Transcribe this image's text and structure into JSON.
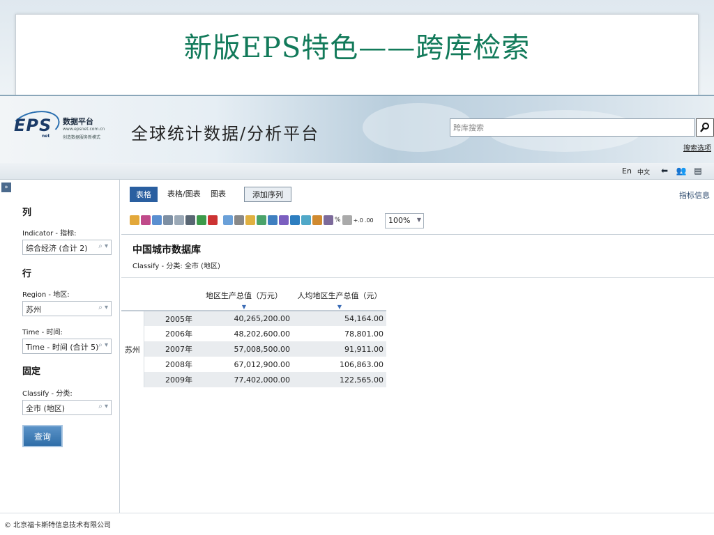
{
  "slide": {
    "title": "新版EPS特色——跨库检索"
  },
  "header": {
    "logo_mark": "EPS",
    "logo_sub": "net",
    "logo_name": "数据平台",
    "logo_url": "www.epsnet.com.cn",
    "logo_slogan": "创造数据服务新模式",
    "platform_title": "全球统计数据/分析平台",
    "search_placeholder": "跨库搜索",
    "search_options": "搜索选项"
  },
  "strip": {
    "lang_en": "En",
    "lang_zh": "中文",
    "icons": [
      "back-icon",
      "users-icon",
      "document-icon"
    ]
  },
  "left_panel": {
    "column_title": "列",
    "indicator_label": "Indicator - 指标:",
    "indicator_value": "综合经济 (合计 2)",
    "row_title": "行",
    "region_label": "Region - 地区:",
    "region_value": "苏州",
    "time_label": "Time - 时间:",
    "time_value": "Time - 时间 (合计 5)",
    "fixed_title": "固定",
    "classify_label": "Classify - 分类:",
    "classify_value": "全市 (地区)",
    "query_button": "查询"
  },
  "main": {
    "tabs": [
      "表格",
      "表格/图表",
      "图表"
    ],
    "add_series": "添加序列",
    "indicator_info": "指标信息",
    "zoom": "100%",
    "db_title": "中国城市数据库",
    "classify_line": "Classify - 分类: 全市 (地区)",
    "table": {
      "columns": [
        "地区生产总值（万元）",
        "人均地区生产总值（元）"
      ],
      "region": "苏州",
      "rows": [
        {
          "year": "2005年",
          "gdp": "40,265,200.00",
          "per_capita": "54,164.00"
        },
        {
          "year": "2006年",
          "gdp": "48,202,600.00",
          "per_capita": "78,801.00"
        },
        {
          "year": "2007年",
          "gdp": "57,008,500.00",
          "per_capita": "91,911.00"
        },
        {
          "year": "2008年",
          "gdp": "67,012,900.00",
          "per_capita": "106,863.00"
        },
        {
          "year": "2009年",
          "gdp": "77,402,000.00",
          "per_capita": "122,565.00"
        }
      ]
    }
  },
  "footer": {
    "text": "© 北京福卡斯特信息技术有限公司"
  },
  "colors": {
    "title_green": "#127a5a",
    "tab_active": "#2a5fa0",
    "query_button": "#2f6ea8"
  }
}
